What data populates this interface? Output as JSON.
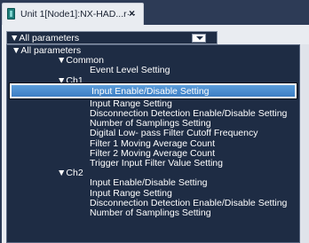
{
  "tab": {
    "title": "Unit 1[Node1]:NX-HAD...r···",
    "close": "×",
    "icon": "unit-config-icon"
  },
  "combo": {
    "value": "▼All parameters"
  },
  "list": {
    "items": [
      {
        "label": "▼All parameters",
        "indent": 0
      },
      {
        "label": "▼Common",
        "indent": 1
      },
      {
        "label": "Event Level Setting",
        "indent": 2
      },
      {
        "label": "▼Ch1",
        "indent": 1
      },
      {
        "label": "Input Enable/Disable Setting",
        "indent": 2,
        "selected": true
      },
      {
        "label": "Input Range Setting",
        "indent": 2
      },
      {
        "label": "Disconnection Detection Enable/Disable Setting",
        "indent": 2
      },
      {
        "label": "Number of Samplings Setting",
        "indent": 2
      },
      {
        "label": "Digital Low- pass Filter Cutoff Frequency",
        "indent": 2
      },
      {
        "label": "Filter 1 Moving Average Count",
        "indent": 2
      },
      {
        "label": "Filter 2 Moving Average Count",
        "indent": 2
      },
      {
        "label": "Trigger Input Filter Value Setting",
        "indent": 2
      },
      {
        "label": "▼Ch2",
        "indent": 1
      },
      {
        "label": "Input Enable/Disable Setting",
        "indent": 2
      },
      {
        "label": "Input Range Setting",
        "indent": 2
      },
      {
        "label": "Disconnection Detection Enable/Disable Setting",
        "indent": 2
      },
      {
        "label": "Number of Samplings Setting",
        "indent": 2
      }
    ]
  }
}
